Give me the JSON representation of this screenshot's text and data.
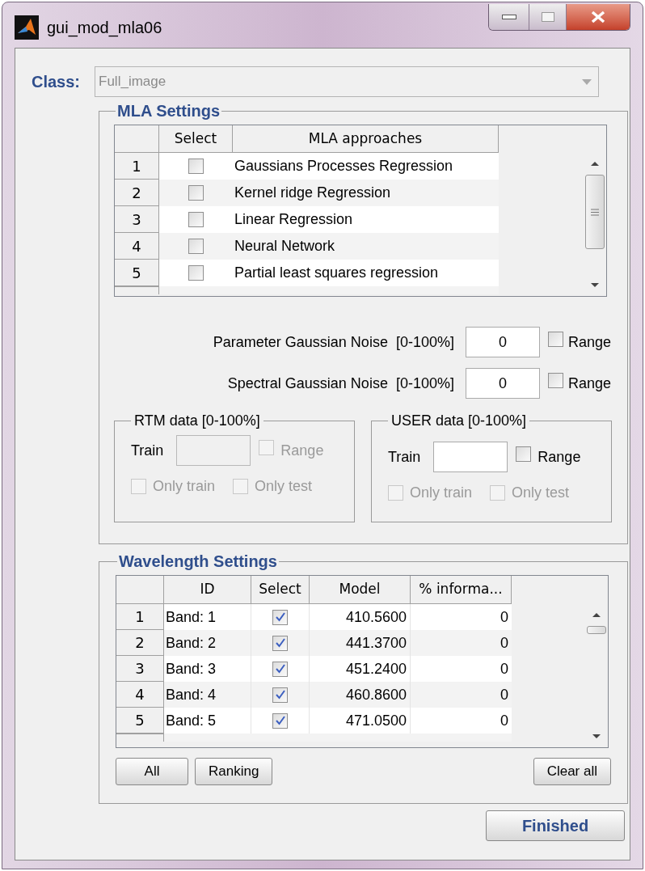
{
  "window": {
    "title": "gui_mod_mla06"
  },
  "class_field": {
    "label": "Class:",
    "value": "Full_image",
    "disabled": true
  },
  "mla_settings": {
    "title": "MLA Settings",
    "columns": [
      "Select",
      "MLA approaches"
    ],
    "rows": [
      {
        "number": "1",
        "checked": false,
        "approach": "Gaussians Processes Regression"
      },
      {
        "number": "2",
        "checked": false,
        "approach": "Kernel ridge Regression"
      },
      {
        "number": "3",
        "checked": false,
        "approach": "Linear Regression"
      },
      {
        "number": "4",
        "checked": false,
        "approach": "Neural Network"
      },
      {
        "number": "5",
        "checked": false,
        "approach": "Partial least squares regression"
      }
    ],
    "noise": [
      {
        "label": "Parameter Gaussian Noise",
        "range_hint": "[0-100%]",
        "value": "0",
        "range_label": "Range",
        "range_checked": false
      },
      {
        "label": "Spectral Gaussian Noise",
        "range_hint": "[0-100%]",
        "value": "0",
        "range_label": "Range",
        "range_checked": false
      }
    ],
    "groups": [
      {
        "title": "RTM data [0-100%]",
        "train_label": "Train",
        "disabled": true,
        "range": {
          "label": "Range",
          "checked": false
        },
        "options": [
          {
            "label": "Only train",
            "checked": false
          },
          {
            "label": "Only test",
            "checked": false
          }
        ]
      },
      {
        "title": "USER data [0-100%]",
        "train_label": "Train",
        "disabled": false,
        "range": {
          "label": "Range",
          "checked": false
        },
        "options": [
          {
            "label": "Only train",
            "checked": false
          },
          {
            "label": "Only test",
            "checked": false
          }
        ]
      }
    ]
  },
  "wavelength_settings": {
    "title": "Wavelength Settings",
    "columns": [
      "ID",
      "Select",
      "Model",
      "% informa..."
    ],
    "rows": [
      {
        "number": "1",
        "id": "Band: 1",
        "checked": true,
        "model": "410.5600",
        "info": "0"
      },
      {
        "number": "2",
        "id": "Band: 2",
        "checked": true,
        "model": "441.3700",
        "info": "0"
      },
      {
        "number": "3",
        "id": "Band: 3",
        "checked": true,
        "model": "451.2400",
        "info": "0"
      },
      {
        "number": "4",
        "id": "Band: 4",
        "checked": true,
        "model": "460.8600",
        "info": "0"
      },
      {
        "number": "5",
        "id": "Band: 5",
        "checked": true,
        "model": "471.0500",
        "info": "0"
      }
    ],
    "buttons": [
      "All",
      "Ranking"
    ],
    "clear_button": "Clear all"
  },
  "finish_button": "Finished"
}
